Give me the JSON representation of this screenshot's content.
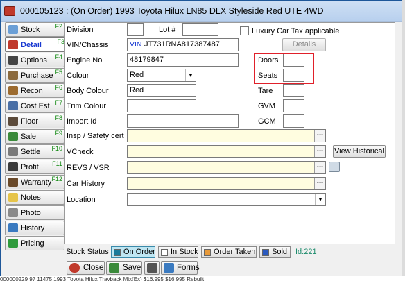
{
  "window": {
    "title": "000105123 : (On Order) 1993 Toyota Hilux LN85 DLX Styleside Red UTE 4WD"
  },
  "nav": [
    {
      "label": "Stock",
      "key": "F2",
      "icon": "stock-icon",
      "color": "#6b9fd6"
    },
    {
      "label": "Detail",
      "key": "F3",
      "icon": "detail-icon",
      "color": "#c0392b"
    },
    {
      "label": "Options",
      "key": "F4",
      "icon": "options-icon",
      "color": "#444444"
    },
    {
      "label": "Purchase",
      "key": "F5",
      "icon": "purchase-icon",
      "color": "#8b6a3d"
    },
    {
      "label": "Recon",
      "key": "F6",
      "icon": "recon-icon",
      "color": "#9c6b2f"
    },
    {
      "label": "Cost Est",
      "key": "F7",
      "icon": "cost-est-icon",
      "color": "#4a6fa5"
    },
    {
      "label": "Floor",
      "key": "F8",
      "icon": "floor-icon",
      "color": "#5b4a3a"
    },
    {
      "label": "Sale",
      "key": "F9",
      "icon": "sale-icon",
      "color": "#3b8a3b"
    },
    {
      "label": "Settle",
      "key": "F10",
      "icon": "settle-icon",
      "color": "#7a7a7a"
    },
    {
      "label": "Profit",
      "key": "F11",
      "icon": "profit-icon",
      "color": "#3a3a3a"
    },
    {
      "label": "Warranty",
      "key": "F12",
      "icon": "warranty-icon",
      "color": "#6a4a2a"
    },
    {
      "label": "Notes",
      "key": "",
      "icon": "notes-icon",
      "color": "#e6c44a"
    },
    {
      "label": "Photo",
      "key": "",
      "icon": "photo-icon",
      "color": "#8a8a8a"
    },
    {
      "label": "History",
      "key": "",
      "icon": "history-icon",
      "color": "#3a7ac0"
    },
    {
      "label": "Pricing",
      "key": "",
      "icon": "pricing-icon",
      "color": "#2e9a3c"
    }
  ],
  "fields": {
    "division": {
      "label": "Division",
      "value": ""
    },
    "lot": {
      "label": "Lot #",
      "value": ""
    },
    "luxury_tax": {
      "label": "Luxury Car Tax applicable",
      "checked": false
    },
    "vin": {
      "label": "VIN/Chassis",
      "prefix": "VIN",
      "value": "JT731RNA817387487"
    },
    "details_button": "Details",
    "engine_no": {
      "label": "Engine No",
      "value": "48179847"
    },
    "doors": {
      "label": "Doors",
      "value": ""
    },
    "colour": {
      "label": "Colour",
      "value": "Red"
    },
    "seats": {
      "label": "Seats",
      "value": ""
    },
    "body_colour": {
      "label": "Body Colour",
      "value": "Red"
    },
    "tare": {
      "label": "Tare",
      "value": ""
    },
    "trim_colour": {
      "label": "Trim Colour",
      "value": ""
    },
    "gvm": {
      "label": "GVM",
      "value": ""
    },
    "import_id": {
      "label": "Import Id",
      "value": ""
    },
    "gcm": {
      "label": "GCM",
      "value": ""
    },
    "insp_safety": {
      "label": "Insp / Safety cert",
      "value": ""
    },
    "vcheck": {
      "label": "VCheck",
      "value": ""
    },
    "view_historical": "View Historical",
    "revs_vsr": {
      "label": "REVS / VSR",
      "value": ""
    },
    "car_history": {
      "label": "Car History",
      "value": ""
    },
    "location": {
      "label": "Location",
      "value": ""
    }
  },
  "status": {
    "label": "Stock Status",
    "options": [
      {
        "label": "On Order",
        "color": "#1a7a9a",
        "active": true
      },
      {
        "label": "In Stock",
        "color": "#ffffff",
        "active": false
      },
      {
        "label": "Order Taken",
        "color": "#e89a3a",
        "active": false
      },
      {
        "label": "Sold",
        "color": "#2a5ac0",
        "active": false
      }
    ],
    "id_text": "Id:221"
  },
  "buttons": {
    "close": "Close",
    "save": "Save",
    "forms": "Forms"
  },
  "dots": "...",
  "background_row": "000000229     97 11475      1993  Toyota  Hilux     Trayback Mix(Ex)           $16,995        $16,995    Rebuilt"
}
